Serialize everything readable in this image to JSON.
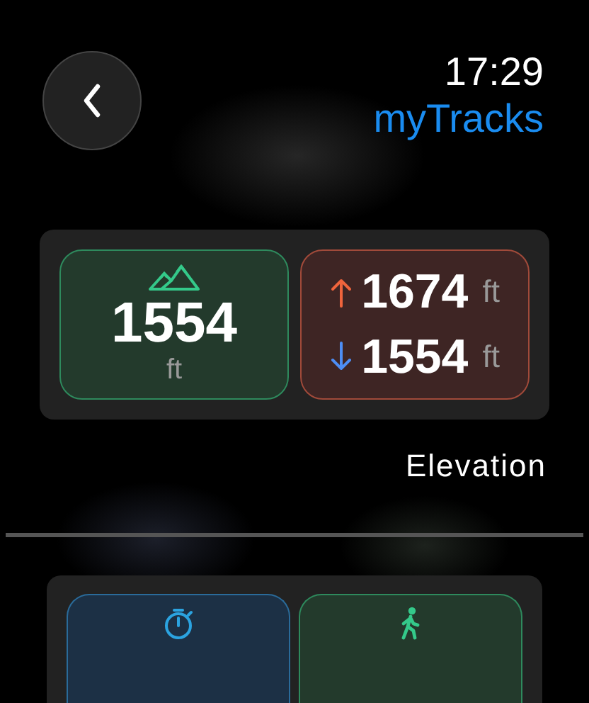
{
  "header": {
    "time": "17:29",
    "app_name": "myTracks"
  },
  "elevation": {
    "current": {
      "value": "1554",
      "unit": "ft"
    },
    "ascent": {
      "value": "1674",
      "unit": "ft"
    },
    "descent": {
      "value": "1554",
      "unit": "ft"
    },
    "label": "Elevation"
  },
  "next_card": {
    "tiles": [
      {
        "kind": "stopwatch"
      },
      {
        "kind": "walking"
      }
    ]
  }
}
